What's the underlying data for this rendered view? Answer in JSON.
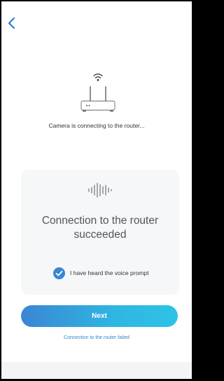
{
  "header": {
    "back_icon": "chevron-left-icon"
  },
  "illustration": {
    "icon": "router-wifi-icon"
  },
  "status": {
    "text": "Camera is connecting to the router..."
  },
  "card": {
    "sound_icon": "sound-wave-icon",
    "title": "Connection to the router succeeded",
    "confirm_label": "I have heard the voice prompt",
    "confirm_checked": true
  },
  "actions": {
    "next_label": "Next",
    "failed_link": "Connection to the router failed"
  },
  "colors": {
    "accent": "#3a86d4",
    "gradient_end": "#2ec3e6",
    "link": "#2d86d0",
    "card_bg": "#f6f7f9"
  }
}
